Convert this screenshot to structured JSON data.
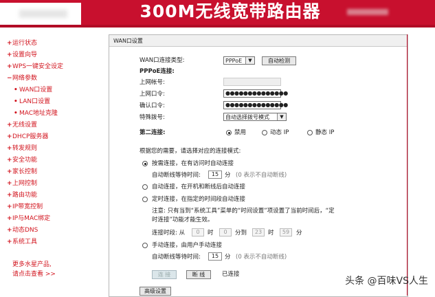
{
  "header": {
    "title": "300M无线宽带路由器"
  },
  "sidebar": {
    "items": [
      {
        "label": "运行状态",
        "bullet": "+"
      },
      {
        "label": "设置向导",
        "bullet": "+"
      },
      {
        "label": "WPS一键安全设定",
        "bullet": "+"
      },
      {
        "label": "网络参数",
        "bullet": "−"
      },
      {
        "label": "WAN口设置",
        "bullet": "•"
      },
      {
        "label": "LAN口设置",
        "bullet": "•"
      },
      {
        "label": "MAC地址克隆",
        "bullet": "•"
      },
      {
        "label": "无线设置",
        "bullet": "+"
      },
      {
        "label": "DHCP服务器",
        "bullet": "+"
      },
      {
        "label": "转发规则",
        "bullet": "+"
      },
      {
        "label": "安全功能",
        "bullet": "+"
      },
      {
        "label": "家长控制",
        "bullet": "+"
      },
      {
        "label": "上网控制",
        "bullet": "+"
      },
      {
        "label": "路由功能",
        "bullet": "+"
      },
      {
        "label": "IP带宽控制",
        "bullet": "+"
      },
      {
        "label": "IP与MAC绑定",
        "bullet": "+"
      },
      {
        "label": "动态DNS",
        "bullet": "+"
      },
      {
        "label": "系统工具",
        "bullet": "+"
      }
    ],
    "more_line1": "更多水星产品,",
    "more_line2": "请点击查看 >>"
  },
  "panel": {
    "title": "WAN口设置",
    "wan_type_label": "WAN口连接类型:",
    "wan_type_value": "PPPoE",
    "auto_detect_button": "自动检测",
    "pppoe_heading": "PPPoE连接:",
    "account_label": "上网帐号:",
    "password_label": "上网口令:",
    "password_value": "●●●●●●●●●●●●●●",
    "confirm_label": "确认口令:",
    "confirm_value": "●●●●●●●●●●●●●●",
    "dial_label": "特殊拨号:",
    "dial_value": "自动选择拨号模式",
    "second_conn_label": "第二连接:",
    "second_opts": [
      "禁用",
      "动态 IP",
      "静态 IP"
    ],
    "mode_prompt": "根据您的需要，请选择对应的连接模式:",
    "mode_ondemand": "按需连接，在有访问时自动连接",
    "idle_label": "自动断线等待时间:",
    "idle_value": "15",
    "idle_unit": "分",
    "idle_hint": "(0 表示不自动断线)",
    "mode_auto": "自动连接，在开机和断线后自动连接",
    "mode_timed": "定时连接，在指定的时间段自动连接",
    "note_line1": "注意: 只有当到“系统工具”菜单的“时间设置”项设置了当前时间后，“定",
    "note_line2": "时连接”功能才能生效。",
    "period_label": "连接时段: 从",
    "period_from_h": "0",
    "period_h": "时",
    "period_from_m": "0",
    "period_to": "分到",
    "period_to_h": "23",
    "period_to_m": "59",
    "period_m": "分",
    "mode_manual": "手动连接，由用户手动连接",
    "idle2_label": "自动断线等待时间:",
    "idle2_value": "15",
    "idle2_unit": "分",
    "idle2_hint": "(0 表示不自动断线)",
    "connect_button": "连 接",
    "disconnect_button": "断 线",
    "status_text": "已连接",
    "advanced_button": "高级设置"
  },
  "watermark": "头条 @百味VS人生",
  "colors": {
    "brand_red": "#c8102e",
    "nav_red": "#d2141e"
  }
}
